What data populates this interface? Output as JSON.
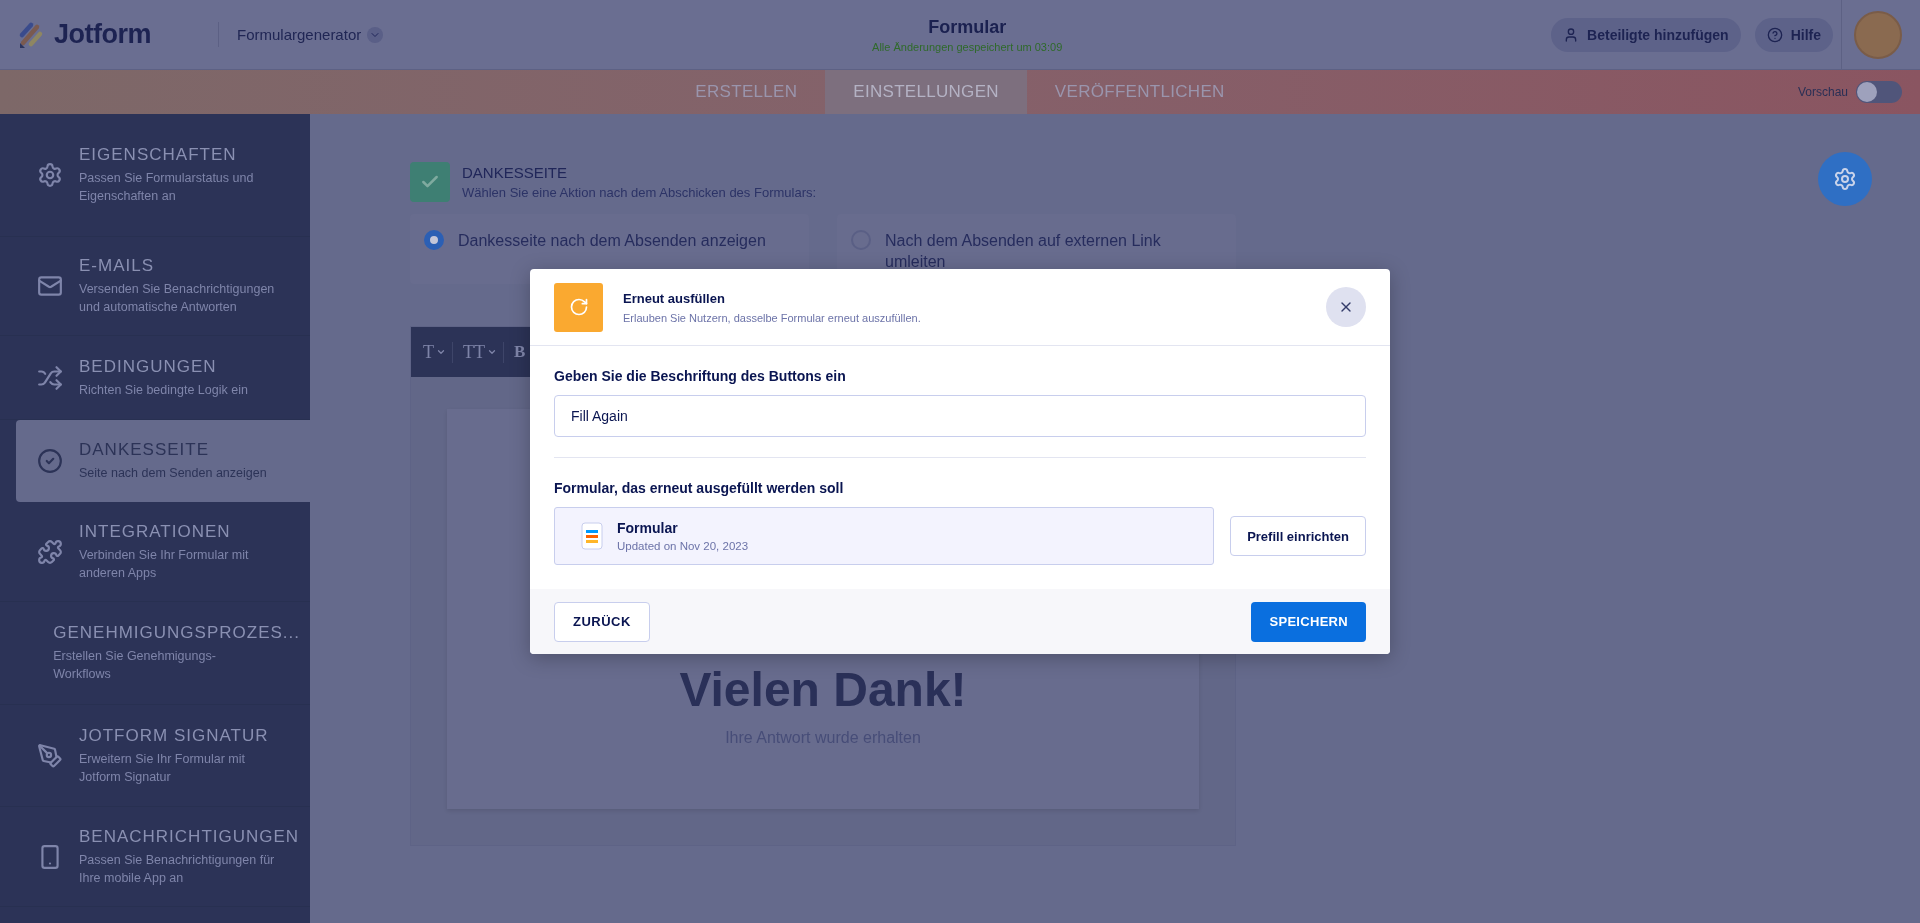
{
  "header": {
    "logo": "Jotform",
    "builder_menu": "Formulargenerator",
    "title": "Formular",
    "save_status": "Alle Änderungen gespeichert um 03:09",
    "buttons": [
      {
        "kind": "invite",
        "label": "Beteiligte hinzufügen"
      },
      {
        "kind": "help",
        "label": "Hilfe"
      }
    ]
  },
  "tabs": [
    {
      "label": "ERSTELLEN",
      "selected": false
    },
    {
      "label": "EINSTELLUNGEN",
      "selected": true
    },
    {
      "label": "VERÖFFENTLICHEN",
      "selected": false
    }
  ],
  "preview": {
    "label": "Vorschau",
    "on": false
  },
  "sidebar": {
    "items": [
      {
        "kind": "properties",
        "title": "EIGENSCHAFTEN",
        "description": "Passen Sie Formularstatus und Eigenschaften an",
        "selected": false
      },
      {
        "kind": "emails",
        "title": "E-MAILS",
        "description": "Versenden Sie Benachrichtigungen und automatische Antworten",
        "selected": false
      },
      {
        "kind": "conditions",
        "title": "BEDINGUNGEN",
        "description": "Richten Sie bedingte Logik ein",
        "selected": false
      },
      {
        "kind": "thankyou",
        "title": "DANKESSEITE",
        "description": "Seite nach dem Senden anzeigen",
        "selected": true
      },
      {
        "kind": "integrations",
        "title": "INTEGRATIONEN",
        "description": "Verbinden Sie Ihr Formular mit anderen Apps",
        "selected": false
      },
      {
        "kind": "approvals",
        "title": "GENEHMIGUNGSPROZES...",
        "description": "Erstellen Sie Genehmigungs-Workflows",
        "selected": false
      },
      {
        "kind": "signature",
        "title": "JOTFORM SIGNATUR",
        "description": "Erweitern Sie Ihr Formular mit Jotform Signatur",
        "selected": false
      },
      {
        "kind": "notifications",
        "title": "BENACHRICHTIGUNGEN",
        "description": "Passen Sie Benachrichtigungen für Ihre mobile App an",
        "selected": false
      }
    ]
  },
  "thank_you": {
    "title": "DANKESSEITE",
    "subtitle": "Wählen Sie eine Aktion nach dem Abschicken des Formulars:",
    "options": [
      {
        "label": "Dankesseite nach dem Absenden anzeigen",
        "selected": true
      },
      {
        "label": "Nach dem Absenden auf externen Link umleiten",
        "selected": false
      }
    ]
  },
  "editor": {
    "toolbar": [
      {
        "kind": "font",
        "label": "T"
      },
      {
        "kind": "size",
        "label": "TT"
      },
      {
        "kind": "bold",
        "label": "B"
      }
    ],
    "heading": "Vielen Dank!",
    "message": "Ihre Antwort wurde erhalten"
  },
  "modal": {
    "title": "Erneut ausfüllen",
    "subtitle": "Erlauben Sie Nutzern, dasselbe Formular erneut auszufüllen.",
    "button_label_field": {
      "label": "Geben Sie die Beschriftung des Buttons ein",
      "value": "Fill Again"
    },
    "form_section": {
      "label": "Formular, das erneut ausgefüllt werden soll",
      "form_title": "Formular",
      "form_updated": "Updated on Nov 20, 2023",
      "prefill_button": "Prefill einrichten"
    },
    "back_button": "ZURÜCK",
    "save_button": "SPEICHERN"
  }
}
